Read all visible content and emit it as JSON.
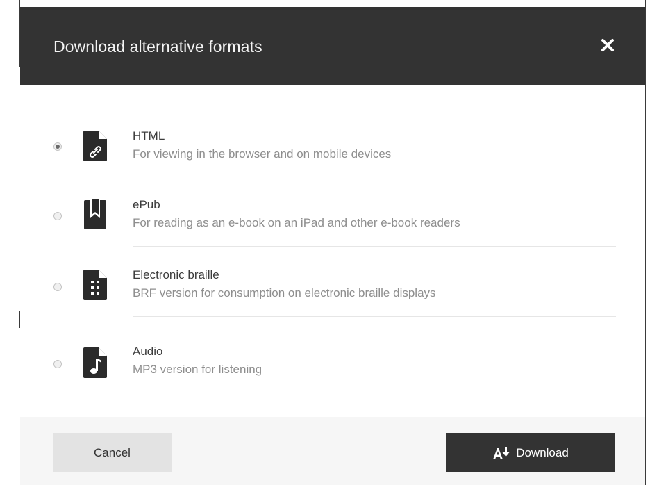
{
  "dialog": {
    "title": "Download alternative formats",
    "close_icon": "close-icon"
  },
  "options": [
    {
      "title": "HTML",
      "description": "For viewing in the browser and on mobile devices",
      "icon": "file-link-icon",
      "selected": true
    },
    {
      "title": "ePub",
      "description": "For reading as an e-book on an iPad and other e-book readers",
      "icon": "book-bookmark-icon",
      "selected": false
    },
    {
      "title": "Electronic braille",
      "description": "BRF version for consumption on electronic braille displays",
      "icon": "file-braille-icon",
      "selected": false
    },
    {
      "title": "Audio",
      "description": "MP3 version for listening",
      "icon": "file-music-icon",
      "selected": false
    }
  ],
  "footer": {
    "cancel_label": "Cancel",
    "download_label": "Download",
    "download_icon": "download-format-icon"
  },
  "colors": {
    "header_bg": "#333333",
    "footer_bg": "#f6f6f6",
    "primary_button": "#333333",
    "secondary_button": "#e3e3e3"
  }
}
